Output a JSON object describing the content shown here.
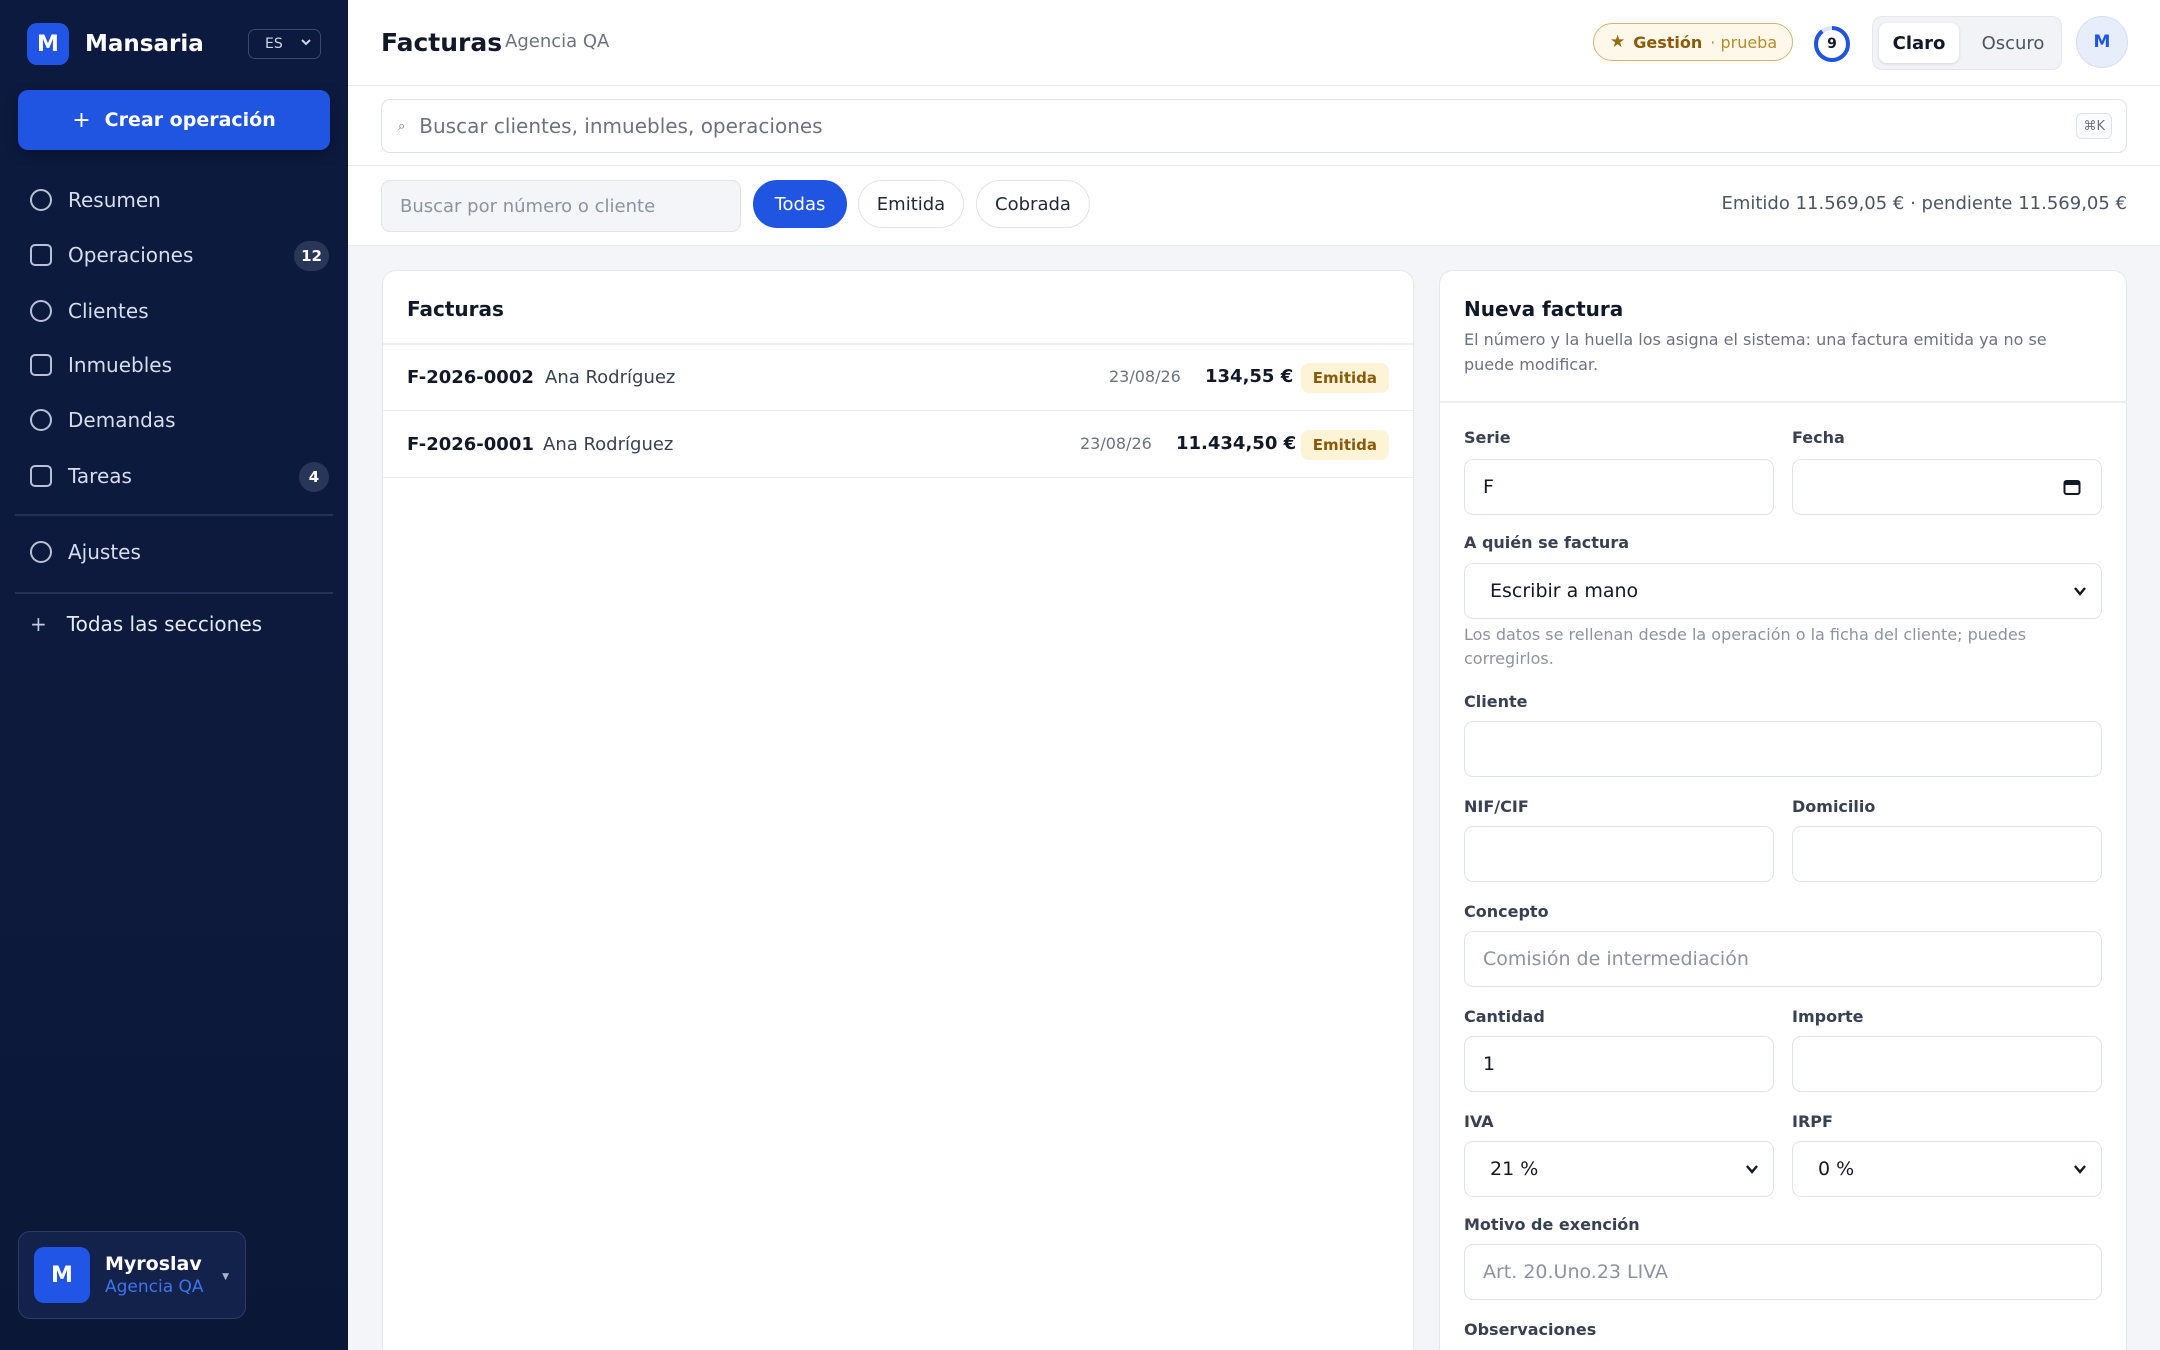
{
  "sidebar": {
    "brand_initial": "M",
    "brand_name": "Mansaria",
    "language": "ES",
    "create_label": "Crear operación",
    "items": [
      {
        "label": "Resumen",
        "badge": ""
      },
      {
        "label": "Operaciones",
        "badge": "12"
      },
      {
        "label": "Clientes",
        "badge": ""
      },
      {
        "label": "Inmuebles",
        "badge": ""
      },
      {
        "label": "Demandas",
        "badge": ""
      },
      {
        "label": "Tareas",
        "badge": "4"
      },
      {
        "label": "Ajustes",
        "badge": ""
      }
    ],
    "all_sections_label": "Todas las secciones",
    "user": {
      "initial": "M",
      "name": "Myroslav",
      "org": "Agencia QA"
    }
  },
  "header": {
    "title": "Facturas",
    "subtitle": "Agencia QA",
    "plan_name": "Gestión",
    "plan_trial": "· prueba",
    "ring_count": "9",
    "theme_light": "Claro",
    "theme_dark": "Oscuro",
    "avatar_initial": "M"
  },
  "search": {
    "placeholder": "Buscar clientes, inmuebles, operaciones",
    "shortcut": "⌘K"
  },
  "filters": {
    "placeholder": "Buscar por número o cliente",
    "chips": [
      "Todas",
      "Emitida",
      "Cobrada"
    ],
    "active": "Todas",
    "totals": "Emitido 11.569,05 € · pendiente 11.569,05 €"
  },
  "invoices": {
    "title": "Facturas",
    "rows": [
      {
        "number": "F-2026-0002",
        "client": "Ana Rodríguez",
        "date": "23/08/26",
        "amount": "134,55 €",
        "status": "Emitida"
      },
      {
        "number": "F-2026-0001",
        "client": "Ana Rodríguez",
        "date": "23/08/26",
        "amount": "11.434,50 €",
        "status": "Emitida"
      }
    ]
  },
  "form": {
    "title": "Nueva factura",
    "description": "El número y la huella los asigna el sistema: una factura emitida ya no se puede modificar.",
    "serie_label": "Serie",
    "serie_value": "F",
    "fecha_label": "Fecha",
    "fecha_value": "",
    "bill_to_label": "A quién se factura",
    "bill_to_value": "Escribir a mano",
    "bill_to_help": "Los datos se rellenan desde la operación o la ficha del cliente; puedes corregirlos.",
    "cliente_label": "Cliente",
    "cliente_value": "",
    "nif_label": "NIF/CIF",
    "nif_value": "",
    "domicilio_label": "Domicilio",
    "domicilio_value": "",
    "concepto_label": "Concepto",
    "concepto_placeholder": "Comisión de intermediación",
    "cantidad_label": "Cantidad",
    "cantidad_value": "1",
    "importe_label": "Importe",
    "importe_value": "",
    "iva_label": "IVA",
    "iva_value": "21 %",
    "irpf_label": "IRPF",
    "irpf_value": "0 %",
    "motivo_label": "Motivo de exención",
    "motivo_placeholder": "Art. 20.Uno.23 LIVA",
    "observaciones_label": "Observaciones"
  },
  "colors": {
    "accent": "#1f55e0",
    "sidebar_bg": "#0c1a3f",
    "badge_bg": "#fdf3d6",
    "badge_text": "#8a5a09"
  }
}
